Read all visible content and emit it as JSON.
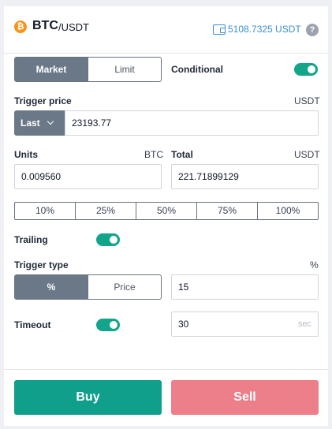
{
  "header": {
    "coin_icon": "bitcoin-icon",
    "coin_glyph": "₿",
    "base": "BTC",
    "quote": "/USDT",
    "wallet_icon": "wallet-icon",
    "balance": "5108.7325 USDT",
    "help_glyph": "?"
  },
  "order_type": {
    "tabs": [
      {
        "label": "Market",
        "active": true
      },
      {
        "label": "Limit",
        "active": false
      }
    ],
    "conditional_label": "Conditional",
    "conditional_on": true
  },
  "trigger_price": {
    "label": "Trigger price",
    "unit": "USDT",
    "mode": "Last",
    "value": "23193.77"
  },
  "units": {
    "label": "Units",
    "unit": "BTC",
    "value": "0.009560"
  },
  "total": {
    "label": "Total",
    "unit": "USDT",
    "value": "221.71899129"
  },
  "percent_options": [
    "10%",
    "25%",
    "50%",
    "75%",
    "100%"
  ],
  "trailing": {
    "label": "Trailing",
    "on": true
  },
  "trigger_type": {
    "label": "Trigger type",
    "unit": "%",
    "tabs": [
      {
        "label": "%",
        "active": true
      },
      {
        "label": "Price",
        "active": false
      }
    ],
    "value": "15"
  },
  "timeout": {
    "label": "Timeout",
    "on": true,
    "value": "30",
    "placeholder": "sec"
  },
  "actions": {
    "buy": "Buy",
    "sell": "Sell"
  },
  "colors": {
    "accent": "#12a58a",
    "buy": "#0f9f8a",
    "sell": "#ec7f8a",
    "balance": "#3a8fd0",
    "segment_active": "#6b7888"
  }
}
